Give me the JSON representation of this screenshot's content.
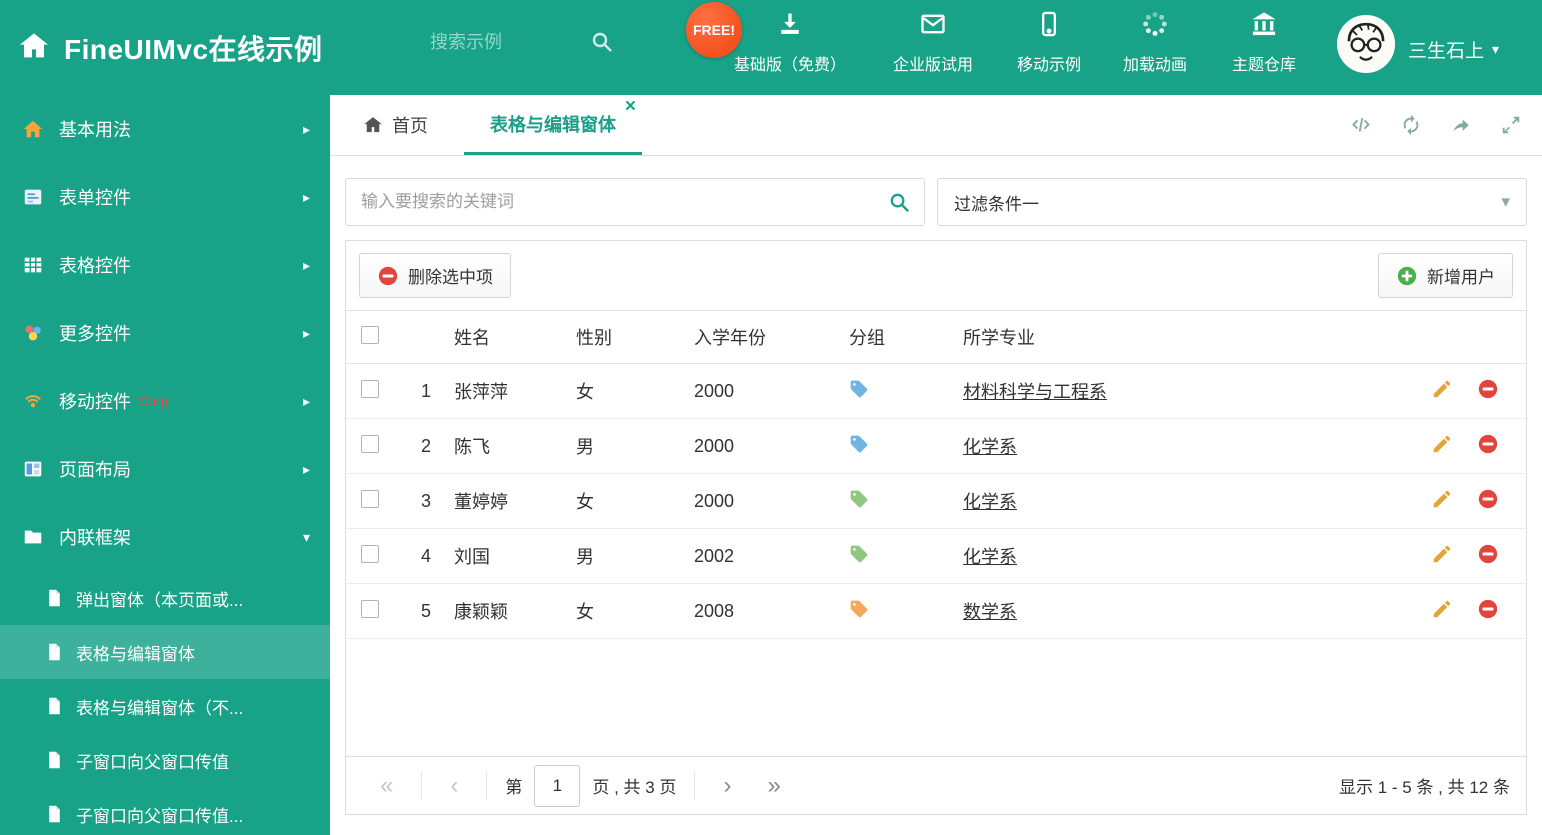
{
  "colors": {
    "theme": "#18A288",
    "tag_blue": "#6FB4E3",
    "tag_green": "#8FC680",
    "tag_orange": "#F2A95C",
    "delete_red": "#E2453C",
    "add_green": "#4BAE4F",
    "pencil_orange": "#E5A437"
  },
  "icons": {
    "close": "×",
    "chevron_right": "▸",
    "caret_down": "▾",
    "pager_first": "«",
    "pager_prev": "‹",
    "pager_next": "›",
    "pager_last": "»"
  },
  "header": {
    "title": "FineUIMvc在线示例",
    "search_placeholder": "搜索示例",
    "free_badge": "FREE!",
    "nav": [
      {
        "label": "基础版（免费）"
      },
      {
        "label": "企业版试用"
      },
      {
        "label": "移动示例"
      },
      {
        "label": "加载动画"
      },
      {
        "label": "主题仓库"
      }
    ],
    "user_name": "三生石上"
  },
  "sidebar": {
    "items": [
      {
        "label": "基本用法"
      },
      {
        "label": "表单控件"
      },
      {
        "label": "表格控件"
      },
      {
        "label": "更多控件"
      },
      {
        "label": "移动控件",
        "badge": "Corp"
      },
      {
        "label": "页面布局"
      },
      {
        "label": "内联框架"
      }
    ],
    "subitems": [
      {
        "label": "弹出窗体（本页面或..."
      },
      {
        "label": "表格与编辑窗体"
      },
      {
        "label": "表格与编辑窗体（不..."
      },
      {
        "label": "子窗口向父窗口传值"
      },
      {
        "label": "子窗口向父窗口传值..."
      }
    ]
  },
  "tabs": {
    "home": "首页",
    "active": "表格与编辑窗体"
  },
  "filter": {
    "search_placeholder": "输入要搜索的关键词",
    "dropdown_value": "过滤条件一"
  },
  "toolbar": {
    "delete_selected": "删除选中项",
    "add_user": "新增用户"
  },
  "table": {
    "headers": [
      "姓名",
      "性别",
      "入学年份",
      "分组",
      "所学专业"
    ],
    "rows": [
      {
        "num": "1",
        "name": "张萍萍",
        "gender": "女",
        "year": "2000",
        "tag_color": "#6FB4E3",
        "major": "材料科学与工程系"
      },
      {
        "num": "2",
        "name": "陈飞",
        "gender": "男",
        "year": "2000",
        "tag_color": "#6FB4E3",
        "major": "化学系"
      },
      {
        "num": "3",
        "name": "董婷婷",
        "gender": "女",
        "year": "2000",
        "tag_color": "#8FC680",
        "major": "化学系"
      },
      {
        "num": "4",
        "name": "刘国",
        "gender": "男",
        "year": "2002",
        "tag_color": "#8FC680",
        "major": "化学系"
      },
      {
        "num": "5",
        "name": "康颖颖",
        "gender": "女",
        "year": "2008",
        "tag_color": "#F2A95C",
        "major": "数学系"
      }
    ]
  },
  "pagination": {
    "label_page": "第",
    "current_page": "1",
    "label_total": "页 , 共 3 页",
    "summary": "显示 1 - 5 条 , 共 12 条"
  }
}
